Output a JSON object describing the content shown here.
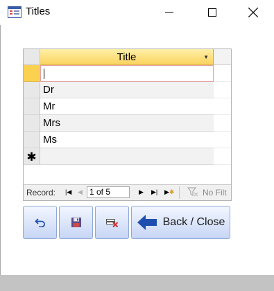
{
  "window": {
    "title": "Titles",
    "icons": {
      "app": "form-icon",
      "minimize": "minimize-icon",
      "maximize": "maximize-icon",
      "close": "close-icon"
    }
  },
  "grid": {
    "column_header": "Title",
    "rows": [
      {
        "value": "",
        "selector": ""
      },
      {
        "value": "Dr",
        "selector": ""
      },
      {
        "value": "Mr",
        "selector": ""
      },
      {
        "value": "Mrs",
        "selector": ""
      },
      {
        "value": "Ms",
        "selector": ""
      },
      {
        "value": "",
        "selector": "✱"
      }
    ],
    "active_row": 0
  },
  "navigation": {
    "record_label": "Record:",
    "record_position": "1 of 5",
    "filter_label": "No Filt",
    "icons": [
      "first-record-icon",
      "previous-record-icon",
      "next-record-icon",
      "last-record-icon",
      "new-record-icon",
      "filter-icon"
    ]
  },
  "buttons": {
    "undo": {
      "icon": "undo-icon"
    },
    "save": {
      "icon": "save-icon"
    },
    "delete": {
      "icon": "delete-record-icon"
    },
    "back_close": {
      "label": "Back / Close",
      "icon": "back-arrow-icon"
    }
  },
  "colors": {
    "header_gradient_top": "#fff0a8",
    "header_gradient_bottom": "#fbd35e",
    "active_selector": "#fcd14f",
    "button_gradient_top": "#f2f6ff",
    "button_gradient_bottom": "#c7d6f5",
    "arrow_blue": "#1e4fb0"
  }
}
